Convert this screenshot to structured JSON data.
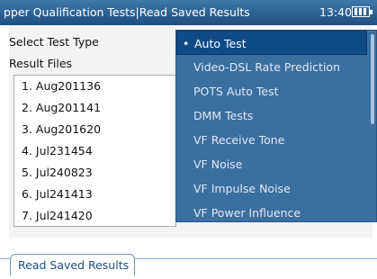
{
  "header": {
    "title": "pper Qualification Tests|Read Saved Results",
    "time": "13:40"
  },
  "labels": {
    "select_test_type": "Select Test Type",
    "result_files": "Result Files"
  },
  "result_files": [
    "1. Aug201136",
    "2. Aug201141",
    "3. Aug201620",
    "4. Jul231454",
    "5. Jul240823",
    "6. Jul241413",
    "7. Jul241420"
  ],
  "dropdown": {
    "selected_index": 0,
    "items": [
      "Auto Test",
      "Video-DSL Rate Prediction",
      "POTS Auto Test",
      "DMM Tests",
      "VF Receive Tone",
      "VF Noise",
      "VF Impulse Noise",
      "VF Power Influence"
    ]
  },
  "tabs": [
    "Read Saved Results"
  ],
  "colors": {
    "titlebar": "#2a5f91",
    "dropdown_bg": "#3b6f9f",
    "dropdown_selected": "#0f4b87"
  }
}
